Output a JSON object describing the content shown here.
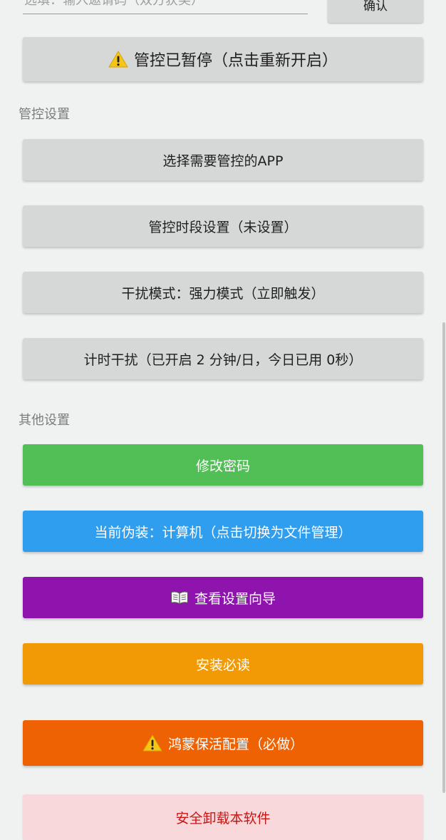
{
  "invite": {
    "placeholder": "选填：输入邀请码（双方获奖）",
    "confirm_label": "确认"
  },
  "control_paused_label": "管控已暂停（点击重新开启）",
  "sections": {
    "control_settings": "管控设置",
    "other_settings": "其他设置"
  },
  "control_buttons": {
    "select_apps": "选择需要管控的APP",
    "time_period": "管控时段设置（未设置）",
    "interference_mode": "干扰模式：强力模式（立即触发）",
    "timed_interference": "计时干扰（已开启 2 分钟/日，今日已用 0秒）"
  },
  "other_buttons": {
    "change_password": "修改密码",
    "disguise": "当前伪装：计算机（点击切换为文件管理）",
    "setup_guide": "查看设置向导",
    "install_notes": "安装必读",
    "harmony_keepalive": "鸿蒙保活配置（必做）",
    "uninstall": "安全卸载本软件"
  },
  "colors": {
    "background": "#f0f1f1",
    "gray_button": "#d6d8d8",
    "green": "#52bf56",
    "blue": "#2f9eee",
    "purple": "#8e14ad",
    "orange": "#f19a05",
    "deep_orange": "#ee6203",
    "pink": "#f8d8da",
    "danger_text": "#c91414"
  },
  "icons": {
    "warning": "warning-icon",
    "book": "open-book-icon"
  }
}
